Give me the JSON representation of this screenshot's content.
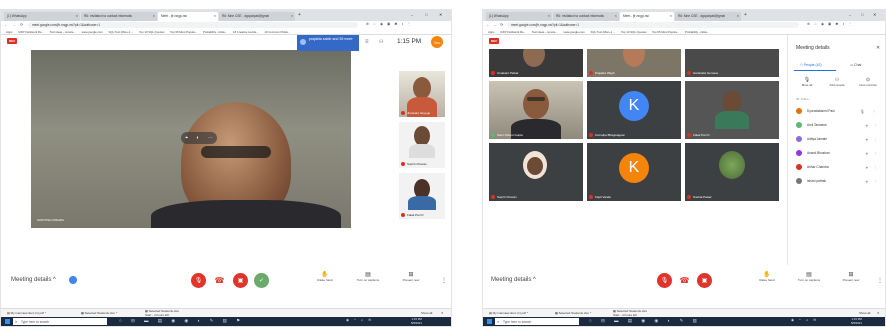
{
  "left": {
    "tabs": [
      "(1) WhatsApp",
      "R6: Invitation to contact informatic",
      "Meet - jfr-nngp-nsi",
      "R6: Mne CSE - dgopalpali@gmai"
    ],
    "url": "meet.google.com/jfr-nngp-nsi?pli=1&authuser=1",
    "bookmarks": [
      "Apps",
      "IUFP Fieldwork Re...",
      "Tool ideas - remote...",
      "www.google.com",
      "SQL Tool (Mon+1 ...",
      "Top 10 SQL Queries",
      "Top 95 Most Popula...",
      "Probability - tickle...",
      "18 Creative Lucide...",
      "10 Common Pickle..."
    ],
    "rec": "REC",
    "presenting_banner": "prajakta sable and 39 more",
    "clock": "1:15 PM",
    "you_label": "You",
    "presenter_name": "SANTOSH MISHRA",
    "participants": [
      {
        "name": "Jimukant Heyege"
      },
      {
        "name": "Supriti Chavan"
      },
      {
        "name": "Falak Pari D"
      }
    ],
    "meeting_details": "Meeting details",
    "controls": {
      "raise_hand": "Raise hand",
      "captions": "Turn on captions",
      "present": "Present now"
    },
    "downloads": [
      "My interview.docx (1).pdf",
      "Selected Students.xlsx",
      "Selected Students.xlsx"
    ],
    "downloads_sub": "Start - 4 hours left",
    "show_all": "Show all",
    "search_placeholder": "Type here to search",
    "taskbar_time": "1:15 PM",
    "taskbar_date": "5/8/2021"
  },
  "right": {
    "tabs": [
      "(1) WhatsApp",
      "R6: Invitation to contact informatic",
      "Meet - jfr-nngp-nsi",
      "R6: Mne CSE - dgopalpali@gmai"
    ],
    "url": "meet.google.com/jfr-nngp-nsi?pli=1&authuser=1",
    "rec": "REC",
    "tiles": [
      {
        "name": "Umakant Petkar"
      },
      {
        "name": "Prajakta Wagh"
      },
      {
        "name": "Harshada Gomane"
      },
      {
        "name": "Sami Oberoi Gupta"
      },
      {
        "name": "Komalpa Bhagwagaon",
        "initial": "K"
      },
      {
        "name": "Falak Pari D"
      },
      {
        "name": "Supriti Chavan"
      },
      {
        "name": "Kapil Vande",
        "initial": "K"
      },
      {
        "name": "Snehal Pawar"
      }
    ],
    "panel_title": "Meeting details",
    "panel_tabs": {
      "people": "People (42)",
      "chat": "Chat"
    },
    "panel_actions": [
      "Mute all",
      "Add people",
      "Host controls"
    ],
    "in_call": "IN CALL",
    "people": [
      {
        "name": "Dyurodakanmi Paul",
        "color": "#e8710a"
      },
      {
        "name": "Avril Tanwane",
        "color": "#5bb974"
      },
      {
        "name": "Aditya Jamale",
        "color": "#8e6ae0"
      },
      {
        "name": "Anand Bhushan",
        "color": "#9334e6"
      },
      {
        "name": "Arihar Chandra",
        "color": "#d93025"
      },
      {
        "name": "Ishani pathak",
        "color": "#777777"
      }
    ],
    "meeting_details": "Meeting details",
    "controls": {
      "raise_hand": "Raise hand",
      "captions": "Turn on captions",
      "present": "Present now"
    },
    "downloads": [
      "My interview.docx (1).pdf",
      "Selected Students.xlsx",
      "Selected Students.xlsx"
    ],
    "downloads_sub": "Start - 4 hours left",
    "show_all": "Show all",
    "search_placeholder": "Type here to search",
    "taskbar_time": "1:15 PM",
    "taskbar_date": "5/8/2021"
  },
  "colors": {
    "meet_red": "#e0352b",
    "rec_red": "#d93025",
    "taskbar": "#1c2a3f",
    "avatar_blue": "#4285f4",
    "avatar_orange": "#f5840b"
  }
}
